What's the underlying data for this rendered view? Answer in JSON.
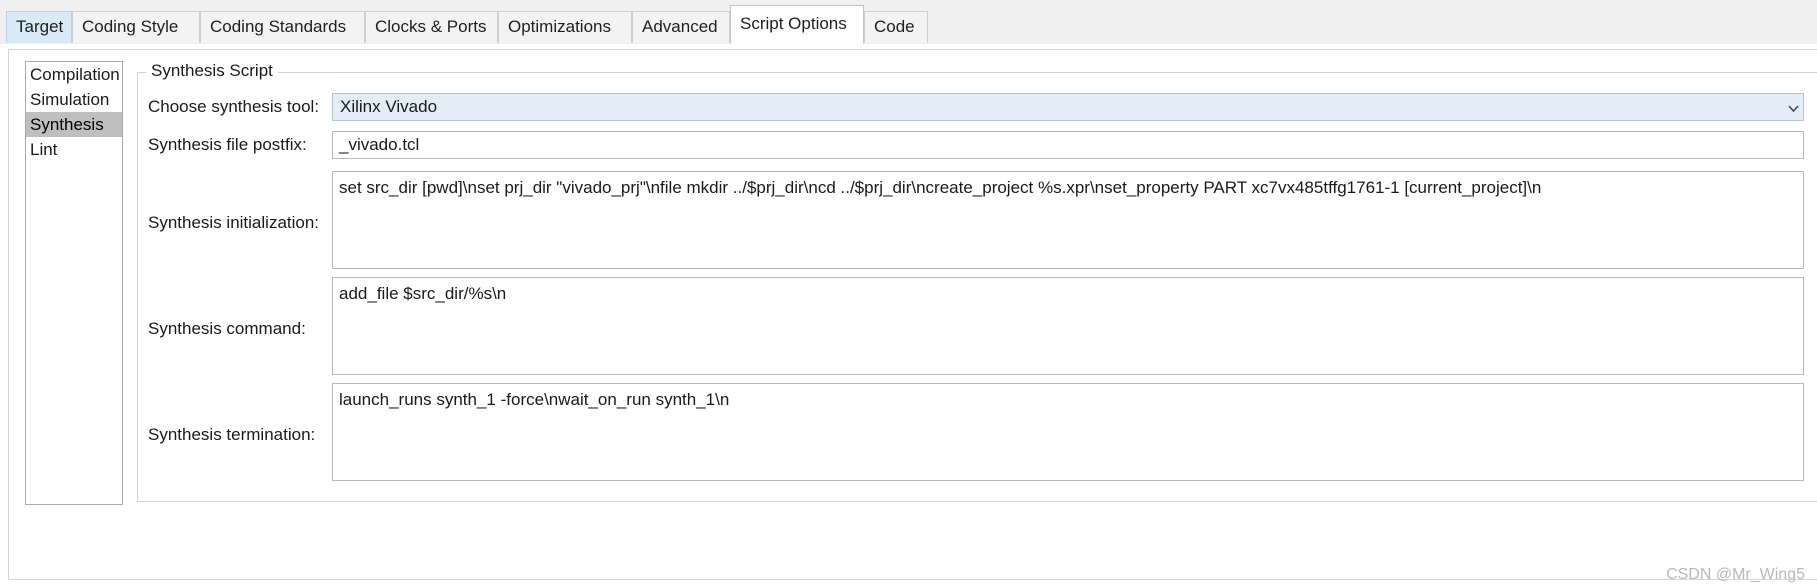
{
  "tabs": [
    {
      "label": "Target",
      "state": "first"
    },
    {
      "label": "Coding Style",
      "state": "normal"
    },
    {
      "label": "Coding Standards",
      "state": "normal"
    },
    {
      "label": "Clocks & Ports",
      "state": "normal"
    },
    {
      "label": "Optimizations",
      "state": "normal"
    },
    {
      "label": "Advanced",
      "state": "normal"
    },
    {
      "label": "Script Options",
      "state": "active"
    },
    {
      "label": "Code",
      "state": "normal"
    }
  ],
  "sidebar": {
    "items": [
      {
        "label": "Compilation",
        "selected": false
      },
      {
        "label": "Simulation",
        "selected": false
      },
      {
        "label": "Synthesis",
        "selected": true
      },
      {
        "label": "Lint",
        "selected": false
      }
    ]
  },
  "group": {
    "title": "Synthesis Script"
  },
  "fields": {
    "tool": {
      "label": "Choose synthesis tool:",
      "value": "Xilinx Vivado"
    },
    "postfix": {
      "label": "Synthesis file postfix:",
      "value": "_vivado.tcl"
    },
    "initialization": {
      "label": "Synthesis initialization:",
      "value": "set src_dir [pwd]\\nset prj_dir \"vivado_prj\"\\nfile mkdir ../$prj_dir\\ncd ../$prj_dir\\ncreate_project %s.xpr\\nset_property PART xc7vx485tffg1761-1 [current_project]\\n"
    },
    "command": {
      "label": "Synthesis command:",
      "value": "add_file $src_dir/%s\\n"
    },
    "termination": {
      "label": "Synthesis termination:",
      "value": "launch_runs synth_1 -force\\nwait_on_run synth_1\\n"
    }
  },
  "watermark": "CSDN @Mr_Wing5",
  "colors": {
    "tab_first_bg": "#d9eaf7",
    "selection_bg": "#bfbfbf",
    "combo_bg": "#e3edf7",
    "watermark_fg": "#b9b9b9"
  }
}
